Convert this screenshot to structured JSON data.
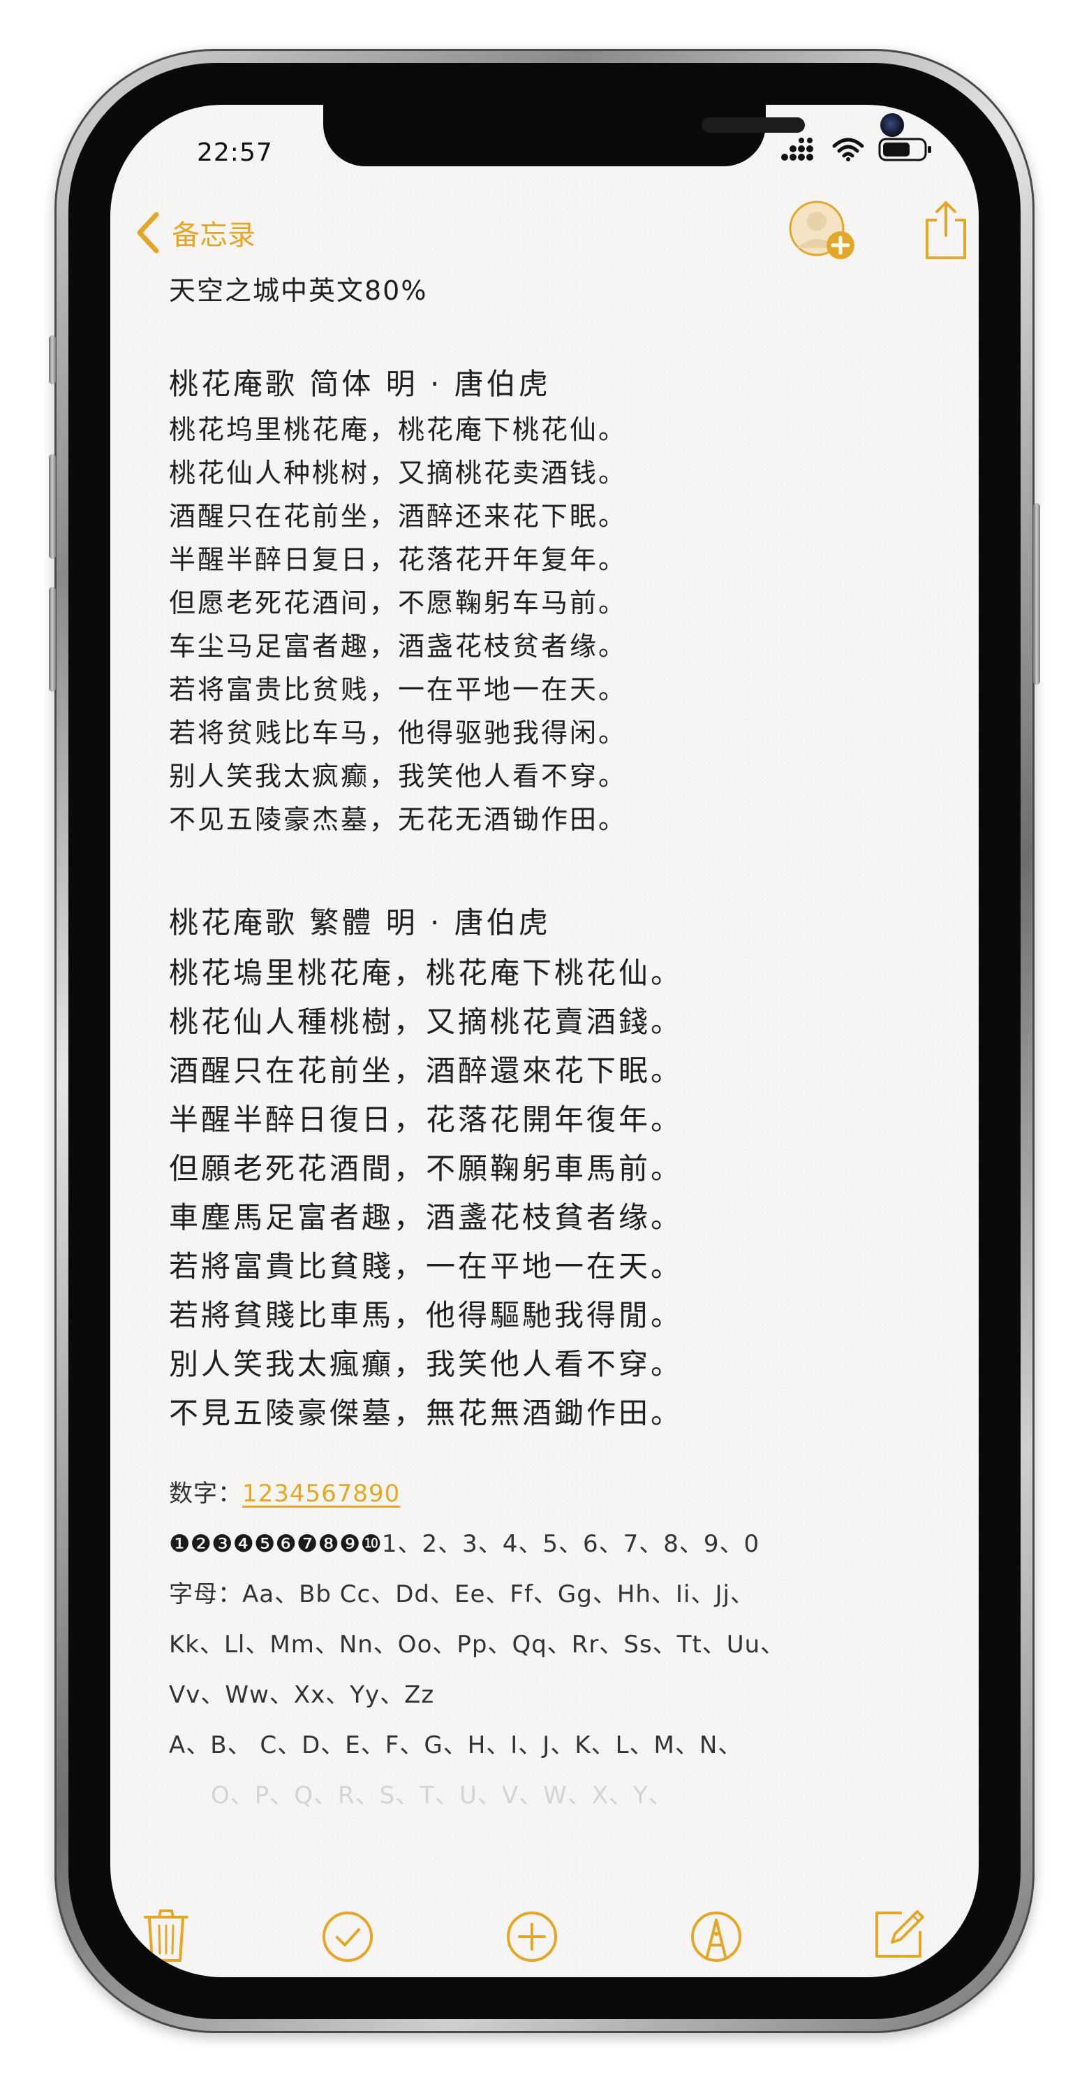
{
  "status_bar": {
    "time": "22:57",
    "icons": [
      "cellular-signal-icon",
      "wifi-icon",
      "battery-icon"
    ]
  },
  "nav": {
    "back_label": "备忘录",
    "icons": [
      "chevron-left-icon",
      "add-person-icon",
      "share-icon"
    ]
  },
  "note": {
    "title": "天空之城中英文80%",
    "poem_simplified": {
      "heading": "桃花庵歌  简体   明 · 唐伯虎",
      "lines": [
        "桃花坞里桃花庵，桃花庵下桃花仙。",
        "桃花仙人种桃树，又摘桃花卖酒钱。",
        "酒醒只在花前坐，酒醉还来花下眠。",
        "半醒半醉日复日，花落花开年复年。",
        "但愿老死花酒间，不愿鞠躬车马前。",
        "车尘马足富者趣，酒盏花枝贫者缘。",
        "若将富贵比贫贱，一在平地一在天。",
        "若将贫贱比车马，他得驱驰我得闲。",
        "别人笑我太疯癫，我笑他人看不穿。",
        "不见五陵豪杰墓，无花无酒锄作田。"
      ]
    },
    "poem_traditional": {
      "heading": "桃花庵歌  繁體     明 · 唐伯虎",
      "lines": [
        "桃花塢里桃花庵，桃花庵下桃花仙。",
        "桃花仙人種桃樹，又摘桃花賣酒錢。",
        "酒醒只在花前坐，酒醉還來花下眠。",
        "半醒半醉日復日，花落花開年復年。",
        "但願老死花酒間，不願鞠躬車馬前。",
        "車塵馬足富者趣，酒盞花枝貧者缘。",
        "若將富貴比貧賤，一在平地一在天。",
        "若將貧賤比車馬，他得驅馳我得閒。",
        "別人笑我太瘋癲，我笑他人看不穿。",
        "不見五陵豪傑墓，無花無酒鋤作田。"
      ]
    },
    "digits_label": "数字：",
    "digits_link": "1234567890",
    "circled_digits": "❶❷❸❹❺❻❼❽❾❿",
    "digits_list": "1、2、3、4、5、6、7、8、9、0",
    "letters_line_1": "字母：Aa、Bb Cc、Dd、Ee、Ff、Gg、Hh、Ii、Jj、",
    "letters_line_2": "Kk、Ll、Mm、Nn、Oo、Pp、Qq、Rr、Ss、Tt、Uu、",
    "letters_line_3": "Vv、Ww、Xx、Yy、Zz",
    "letters_line_4": "A、B、 C、D、E、F、G、H、I、J、K、L、M、N、",
    "letters_line_5_faded": "O、P、Q、R、S、T、U、V、W、X、Y、"
  },
  "toolbar": {
    "icons": [
      "trash-icon",
      "checklist-icon",
      "add-icon",
      "markup-pen-icon",
      "compose-icon"
    ]
  },
  "colors": {
    "accent": "#e2a728",
    "text": "#202020",
    "paper": "#f6f5f3"
  }
}
